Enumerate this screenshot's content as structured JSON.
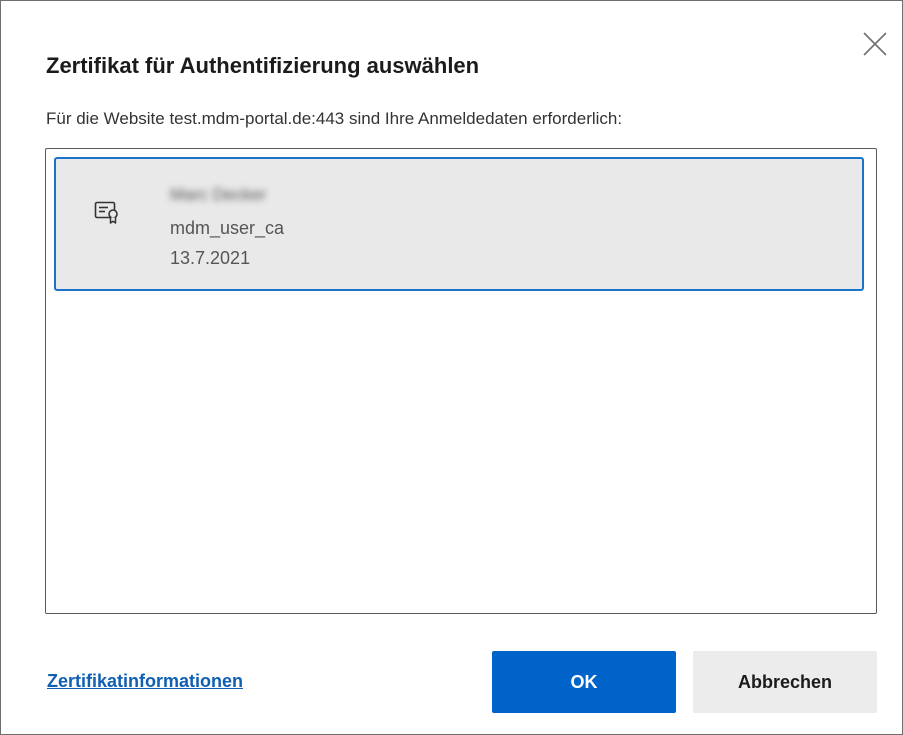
{
  "dialog": {
    "title": "Zertifikat für Authentifizierung auswählen",
    "subtitle": "Für die Website test.mdm-portal.de:443 sind Ihre Anmeldedaten erforderlich:",
    "close_icon": "close-icon"
  },
  "certificates": [
    {
      "icon": "certificate-icon",
      "name": "Marc Decker",
      "issuer": "mdm_user_ca",
      "date": "13.7.2021",
      "selected": true
    }
  ],
  "footer": {
    "link_label": "Zertifikatinformationen",
    "ok_label": "OK",
    "cancel_label": "Abbrechen"
  },
  "colors": {
    "accent": "#0063c9",
    "selection_border": "#1a73c8",
    "selection_bg": "#e9e9e9",
    "link": "#0f5fb3"
  }
}
